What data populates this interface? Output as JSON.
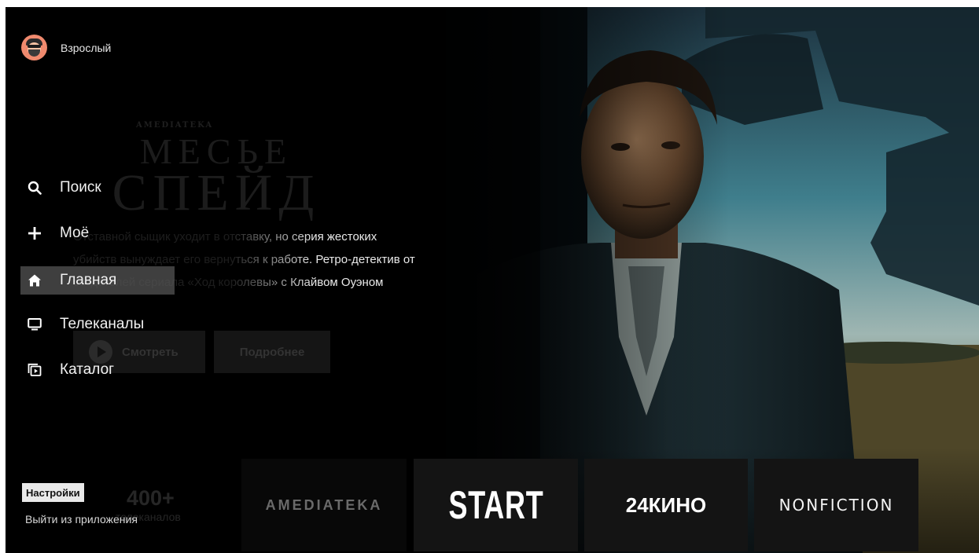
{
  "profile": {
    "name": "Взрослый",
    "avatar_icon": "user-avatar-icon"
  },
  "hero": {
    "brand": "AMEDIATEKA",
    "title_line1": "МЕСЬЕ",
    "title_line2": "СПЕЙД",
    "description_line1": "Отставной сыщик уходит в отставку, но серия жестоких",
    "description_line2": "убийств вынуждает его вернуться к работе. Ретро-детектив от",
    "description_line3": "создателей сериала «Ход королевы» с Клайвом Оуэном",
    "watch_label": "Смотреть",
    "more_label": "Подробнее"
  },
  "nav": {
    "items": [
      {
        "label": "Поиск",
        "icon": "search-icon"
      },
      {
        "label": "Моё",
        "icon": "plus-icon"
      },
      {
        "label": "Главная",
        "icon": "home-icon",
        "active": true
      },
      {
        "label": "Телеканалы",
        "icon": "tv-icon"
      },
      {
        "label": "Каталог",
        "icon": "catalog-icon"
      }
    ]
  },
  "channels_promo": {
    "count": "400+",
    "caption": "телеканалов"
  },
  "footer": {
    "settings": "Настройки",
    "exit": "Выйти из приложения"
  },
  "tiles": [
    {
      "label": "AMEDIATEKA"
    },
    {
      "label": "START"
    },
    {
      "label": "24КИНО"
    },
    {
      "label": "NONFICTION"
    }
  ],
  "colors": {
    "background": "#000000",
    "active_item": "#585858",
    "settings_chip": "#e9e9e9",
    "avatar": "#f08a6e"
  }
}
